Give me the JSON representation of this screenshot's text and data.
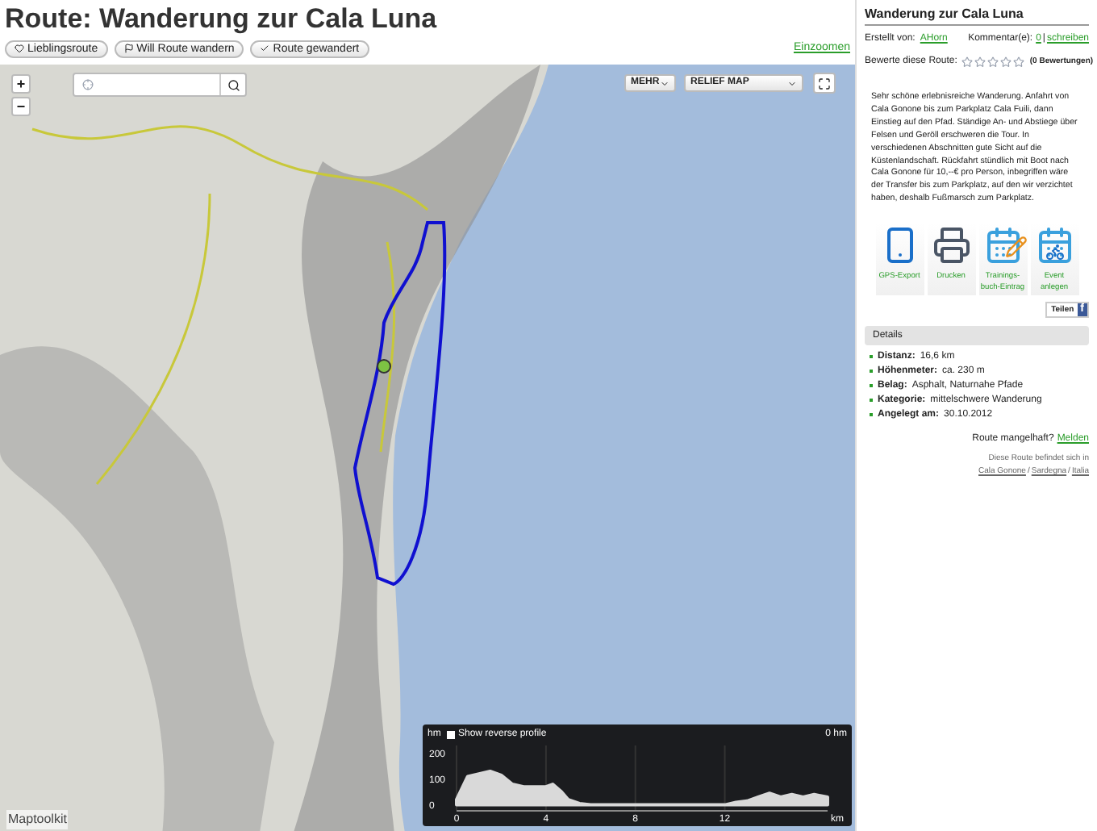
{
  "page_title": "Route: Wanderung zur Cala Luna",
  "actions": [
    {
      "label": "Lieblingsroute",
      "kind": "heart"
    },
    {
      "label": "Will Route wandern",
      "kind": "flag"
    },
    {
      "label": "Route gewandert",
      "kind": "check"
    }
  ],
  "zoom_link": "Einzoomen",
  "map": {
    "zoom_in": "+",
    "zoom_out": "−",
    "more_menu": "MEHR",
    "layer_menu": "RELIEF MAP",
    "logo": "Maptoolkit",
    "profile": {
      "reverse": {
        "label": "Show reverse profile",
        "checked": false
      },
      "distance_label": "0 hm",
      "chart_data": {
        "type": "area",
        "xlabel": "km",
        "ylabel": "hm",
        "x": [
          0,
          0.5,
          1,
          1.5,
          2,
          2.5,
          3,
          3.5,
          4,
          4.3,
          4.7,
          5,
          5.5,
          6,
          8,
          10,
          12,
          12.5,
          13,
          13.5,
          14,
          14.5,
          15,
          15.5,
          16,
          16.6
        ],
        "series": [
          {
            "color": "#d9d9d9",
            "values": [
              20,
              110,
              120,
              130,
              115,
              80,
              70,
              70,
              70,
              80,
              50,
              20,
              5,
              0,
              0,
              0,
              0,
              10,
              15,
              30,
              45,
              30,
              40,
              30,
              40,
              30
            ]
          }
        ],
        "xlim": [
          0,
          16.6
        ],
        "ylim": [
          -20,
          230
        ],
        "grid": true,
        "xticks": [
          0,
          4,
          8,
          12
        ],
        "yticks": [
          0,
          100,
          200
        ]
      }
    }
  },
  "sidebar": {
    "title": "Wanderung zur Cala Luna",
    "author_label": "Erstellt von:",
    "author": "AHorn",
    "comments_label": "Kommentar(e):",
    "comments_count": "0",
    "comments_separator": "|",
    "comments_link": "schreiben",
    "rate_label": "Bewerte diese Route:",
    "stars": 0,
    "ratings": "(0 Bewertungen)",
    "description": "Sehr schöne erlebnisreiche Wanderung. Anfahrt von Cala Gonone bis zum Parkplatz Cala Fuili, dann Einstieg auf den Pfad. Ständige An- und Abstiege über Felsen und Geröll erschweren die Tour. In verschiedenen Abschnitten gute Sicht auf die Küstenlandschaft. Rückfahrt stündlich mit Boot nach Cala Gonone für 10,--€ pro Person, inbegriffen wäre der Transfer bis zum Parkplatz, auf den wir verzichtet haben, deshalb Fußmarsch zum Parkplatz.",
    "tools": [
      {
        "label": "GPS-Export",
        "kind": "phone"
      },
      {
        "label": "Drucken",
        "kind": "printer"
      },
      {
        "label": "Trainings-buch-Eintrag",
        "kind": "calendar-pencil"
      },
      {
        "label": "Event anlegen",
        "kind": "calendar-bike"
      }
    ],
    "share": "Teilen",
    "share_icon": "f",
    "details_title": "Details",
    "details": [
      {
        "label": "Distanz:",
        "value": "16,6 km"
      },
      {
        "label": "Höhenmeter:",
        "value": "ca. 230 m"
      },
      {
        "label": "Belag:",
        "value": "Asphalt, Naturnahe Pfade"
      },
      {
        "label": "Kategorie:",
        "value": "mittelschwere Wanderung"
      },
      {
        "label": "Angelegt am:",
        "value": "30.10.2012"
      }
    ],
    "report_label": "Route mangelhaft?",
    "report_link": "Melden",
    "location_label": "Diese Route befindet sich in",
    "location_separator": "/",
    "location": [
      "Cala Gonone",
      "Sardegna",
      "Italia"
    ]
  }
}
